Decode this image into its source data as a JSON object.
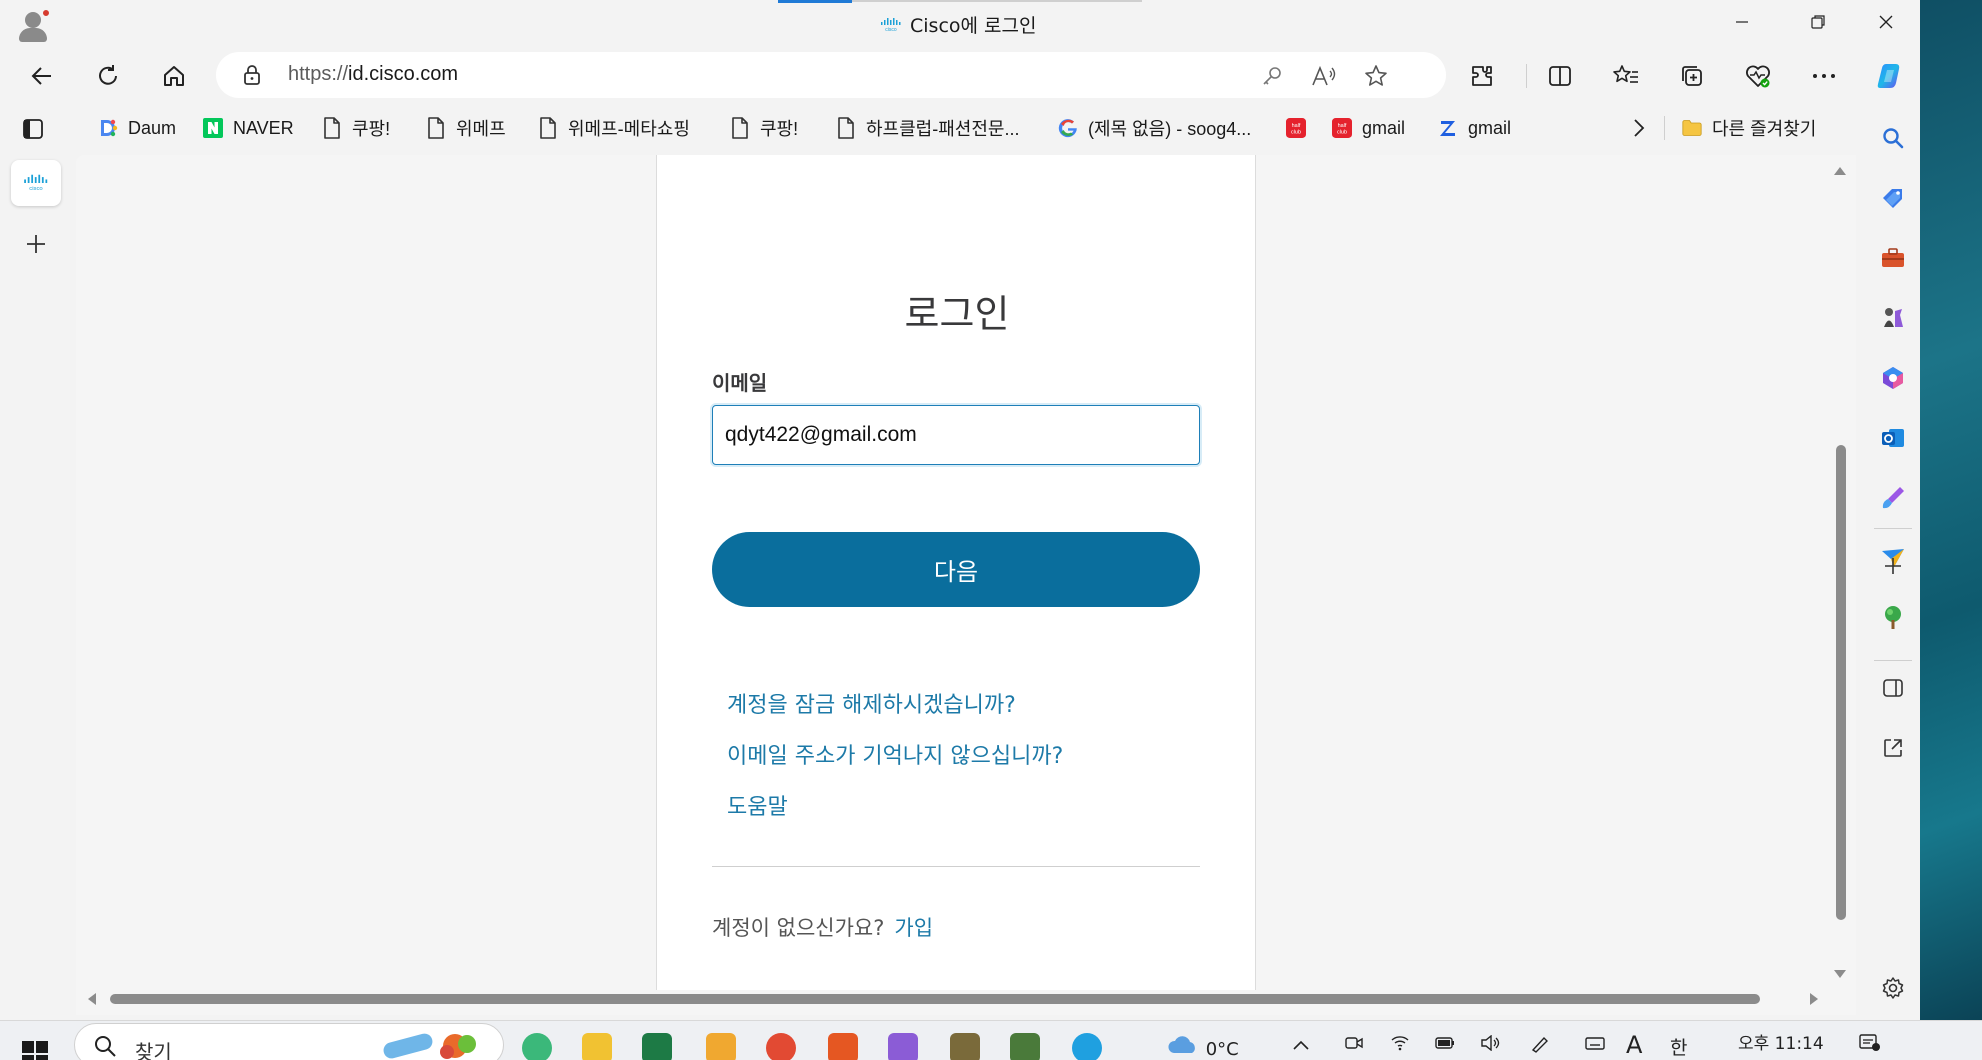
{
  "window": {
    "title": "Cisco에 로그인",
    "minimize_icon": "minimize-icon",
    "restore_icon": "restore-icon",
    "close_icon": "close-icon"
  },
  "addressbar": {
    "url_protocol": "https://",
    "url_host": "id.cisco.com",
    "icons": [
      "back-icon",
      "refresh-icon",
      "home-icon",
      "lock-icon",
      "key-icon",
      "read-aloud-icon",
      "favorite-star-icon",
      "extensions-icon",
      "split-screen-icon",
      "favorites-icon",
      "collections-icon",
      "browser-essentials-icon",
      "more-icon",
      "copilot-icon"
    ]
  },
  "favorites": [
    {
      "label": "Daum",
      "icon": "daum-icon"
    },
    {
      "label": "NAVER",
      "icon": "naver-icon"
    },
    {
      "label": "쿠팡!",
      "icon": "page-icon"
    },
    {
      "label": "위메프",
      "icon": "page-icon"
    },
    {
      "label": "위메프-메타쇼핑",
      "icon": "page-icon"
    },
    {
      "label": "쿠팡!",
      "icon": "page-icon"
    },
    {
      "label": "하프클럽-패션전문...",
      "icon": "page-icon"
    },
    {
      "label": "(제목 없음) - soog4...",
      "icon": "google-icon"
    },
    {
      "label": "",
      "icon": "halfclub-icon"
    },
    {
      "label": "gmail",
      "icon": "halfclub-icon"
    },
    {
      "label": "gmail",
      "icon": "z-icon"
    }
  ],
  "favorites_other": "다른 즐겨찾기",
  "login": {
    "title": "로그인",
    "email_label": "이메일",
    "email_value": "qdyt422@gmail.com",
    "next_button": "다음",
    "links": [
      "계정을 잠금 해제하시겠습니까?",
      "이메일 주소가 기억나지 않으십니까?",
      "도움말"
    ],
    "no_account_text": "계정이 없으신가요?",
    "signup_link": "가입"
  },
  "taskbar": {
    "search_placeholder": "찾기",
    "weather": "0°C",
    "ime_mode": "A",
    "ime_lang": "한",
    "time": "오후 11:14"
  },
  "colors": {
    "primary_button": "#0a6e9d",
    "link": "#1d7aa8",
    "input_focus": "#1e7fb8"
  }
}
